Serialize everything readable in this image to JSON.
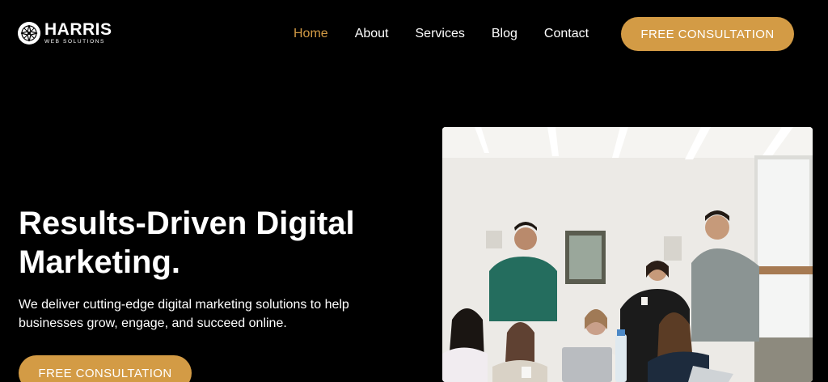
{
  "brand": {
    "name": "HARRIS",
    "tagline": "WEB SOLUTIONS"
  },
  "nav": {
    "items": [
      "Home",
      "About",
      "Services",
      "Blog",
      "Contact"
    ],
    "active": "Home"
  },
  "header": {
    "cta_label": "FREE CONSULTATION"
  },
  "hero": {
    "title_line1": "Results-Driven Digital",
    "title_line2": "Marketing.",
    "subtitle_line1": "We deliver cutting-edge digital marketing solutions to help",
    "subtitle_line2": "businesses grow, engage, and succeed online.",
    "cta_label": "FREE CONSULTATION"
  },
  "colors": {
    "accent": "#d39b45",
    "background": "#000000",
    "text": "#ffffff"
  },
  "image": {
    "subject": "team-meeting-photo"
  }
}
